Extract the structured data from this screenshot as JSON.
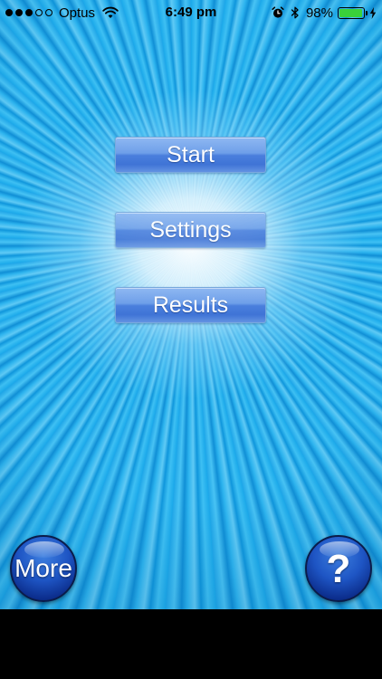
{
  "status_bar": {
    "signal_bars_filled": 3,
    "signal_bars_total": 5,
    "carrier": "Optus",
    "wifi_icon": "wifi-icon",
    "time": "6:49 pm",
    "alarm_icon": "alarm-clock-icon",
    "bluetooth_icon": "bluetooth-icon",
    "battery_percent": "98%",
    "battery_level": 0.98,
    "battery_color": "#3ad13a",
    "charging_icon": "lightning-bolt-icon"
  },
  "menu": {
    "start_label": "Start",
    "settings_label": "Settings",
    "results_label": "Results"
  },
  "bottom": {
    "more_label": "More",
    "help_label": "?"
  },
  "colors": {
    "background_blue": "#1aa8ea",
    "button_blue": "#4a7fdd",
    "round_button_blue": "#1e55c4"
  }
}
